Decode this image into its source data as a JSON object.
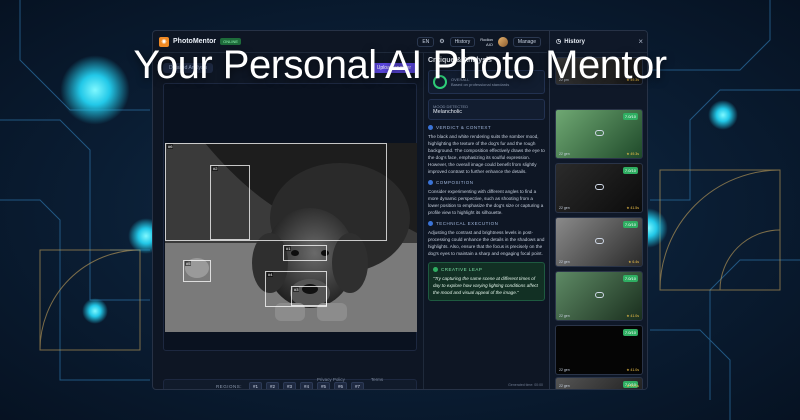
{
  "headline": "Your Personal AI Photo Mentor",
  "app": {
    "brand": "PhotoMentor",
    "badge": "ONLINE",
    "lang": "EN",
    "history_btn": "History",
    "user_name": "Rodion",
    "user_sub": "AIO",
    "manage": "Manage"
  },
  "left": {
    "subtitle": "Detailed Analysis",
    "upload": "Upload another",
    "regions_label": "REGIONS:",
    "regions": [
      "#1",
      "#2",
      "#3",
      "#4",
      "#5",
      "#6",
      "#7"
    ],
    "photo_regions": [
      "#6",
      "#2",
      "#1",
      "#5",
      "#4",
      "#3"
    ]
  },
  "critique": {
    "title": "Critique & Analysis",
    "overall_label": "OVERALL",
    "overall_sub": "Based on professional standards",
    "mood_label": "MOOD DETECTED",
    "mood": "Melancholic",
    "verdict_label": "VERDICT & CONTEXT",
    "verdict_text": "The black and white rendering suits the somber mood, highlighting the texture of the dog's fur and the rough background. The composition effectively draws the eye to the dog's face, emphasizing its soulful expression. However, the overall image could benefit from slightly improved contrast to further enhance the details.",
    "composition_label": "COMPOSITION",
    "composition_text": "Consider experimenting with different angles to find a more dynamic perspective, such as shooting from a lower position to emphasize the dog's size or capturing a profile view to highlight its silhouette.",
    "technical_label": "TECHNICAL EXECUTION",
    "technical_text": "Adjusting the contrast and brightness levels in post-processing could enhance the details in the shadows and highlights. Also, ensure that the focus is precisely on the dog's eyes to maintain a sharp and engaging focal point.",
    "creative_label": "CREATIVE LEAP",
    "creative_text": "\"Try capturing the same scene at different times of day to explore how varying lighting conditions affect the mood and visual appeal of the image.\"",
    "generated": "Generated time: 00:00"
  },
  "history": {
    "title": "History",
    "items": [
      {
        "score": "",
        "meta": "22 pm",
        "rating": "★ 49.3s"
      },
      {
        "score": "7.0/10",
        "meta": "22 gen",
        "rating": "★ 49.3s"
      },
      {
        "score": "7.0/10",
        "meta": "22 gen",
        "rating": "★ 41.5s"
      },
      {
        "score": "7.0/10",
        "meta": "22 gen",
        "rating": "★ 6.4s"
      },
      {
        "score": "7.0/10",
        "meta": "22 gen",
        "rating": "★ 41.0s"
      },
      {
        "score": "7.0/10",
        "meta": "22 gen",
        "rating": "★ 41.0s"
      },
      {
        "score": "7.0/10",
        "meta": "22 gen",
        "rating": "★ 41.0s"
      }
    ]
  },
  "footer": {
    "privacy": "Privacy Policy",
    "terms": "Terms"
  }
}
